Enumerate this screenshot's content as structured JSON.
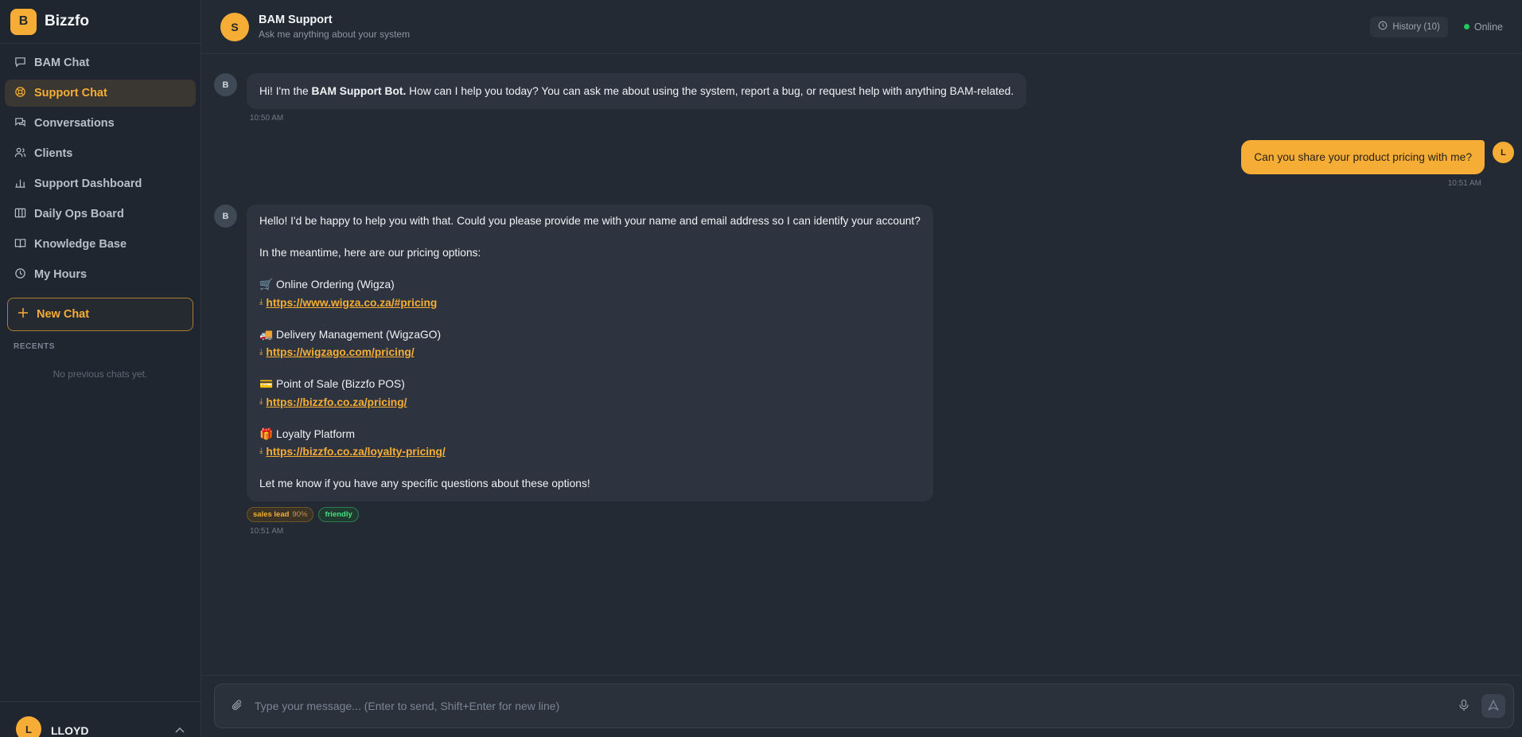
{
  "brand": {
    "logo_letter": "B",
    "name": "Bizzfo"
  },
  "nav": [
    {
      "label": "BAM Chat",
      "icon": "chat-bubble-icon",
      "active": false
    },
    {
      "label": "Support Chat",
      "icon": "lifebuoy-icon",
      "active": true
    },
    {
      "label": "Conversations",
      "icon": "conversations-icon",
      "active": false
    },
    {
      "label": "Clients",
      "icon": "users-icon",
      "active": false
    },
    {
      "label": "Support Dashboard",
      "icon": "bar-chart-icon",
      "active": false
    },
    {
      "label": "Daily Ops Board",
      "icon": "kanban-icon",
      "active": false
    },
    {
      "label": "Knowledge Base",
      "icon": "book-icon",
      "active": false
    },
    {
      "label": "My Hours",
      "icon": "clock-icon",
      "active": false
    }
  ],
  "new_chat": {
    "label": "New Chat"
  },
  "recents": {
    "label": "RECENTS",
    "empty": "No previous chats yet."
  },
  "user": {
    "initial": "L",
    "name": "LLOYD"
  },
  "header": {
    "avatar": "S",
    "title": "BAM Support",
    "subtitle": "Ask me anything about your system",
    "history_label": "History (10)",
    "status": "Online"
  },
  "messages": {
    "m1": {
      "avatar": "B",
      "pre": "Hi! I'm the ",
      "bold": "BAM Support Bot.",
      "post": " How can I help you today? You can ask me about using the system, report a bug, or request help with anything BAM-related.",
      "time": "10:50 AM"
    },
    "m2": {
      "avatar": "L",
      "text": "Can you share your product pricing with me?",
      "time": "10:51 AM"
    },
    "m3": {
      "avatar": "B",
      "intro": "Hello! I'd be happy to help you with that. Could you please provide me with your name and email address so I can identify your account?",
      "options_intro": "In the meantime, here are our pricing options:",
      "items": [
        {
          "emoji": "🛒",
          "name": "Online Ordering (Wigza)",
          "url": "https://www.wigza.co.za/#pricing"
        },
        {
          "emoji": "🚚",
          "name": "Delivery Management (WigzaGO)",
          "url": "https://wigzago.com/pricing/"
        },
        {
          "emoji": "💳",
          "name": "Point of Sale (Bizzfo POS)",
          "url": "https://bizzfo.co.za/pricing/"
        },
        {
          "emoji": "🎁",
          "name": "Loyalty Platform",
          "url": "https://bizzfo.co.za/loyalty-pricing/"
        }
      ],
      "outro": "Let me know if you have any specific questions about these options!",
      "tags": {
        "sales": "sales lead",
        "sales_pct": "90%",
        "friendly": "friendly"
      },
      "time": "10:51 AM"
    }
  },
  "composer": {
    "placeholder": "Type your message... (Enter to send, Shift+Enter for new line)"
  },
  "colors": {
    "accent": "#f6ad35",
    "bg": "#232a34",
    "sidebar": "#1f2630",
    "online": "#22c55e"
  }
}
